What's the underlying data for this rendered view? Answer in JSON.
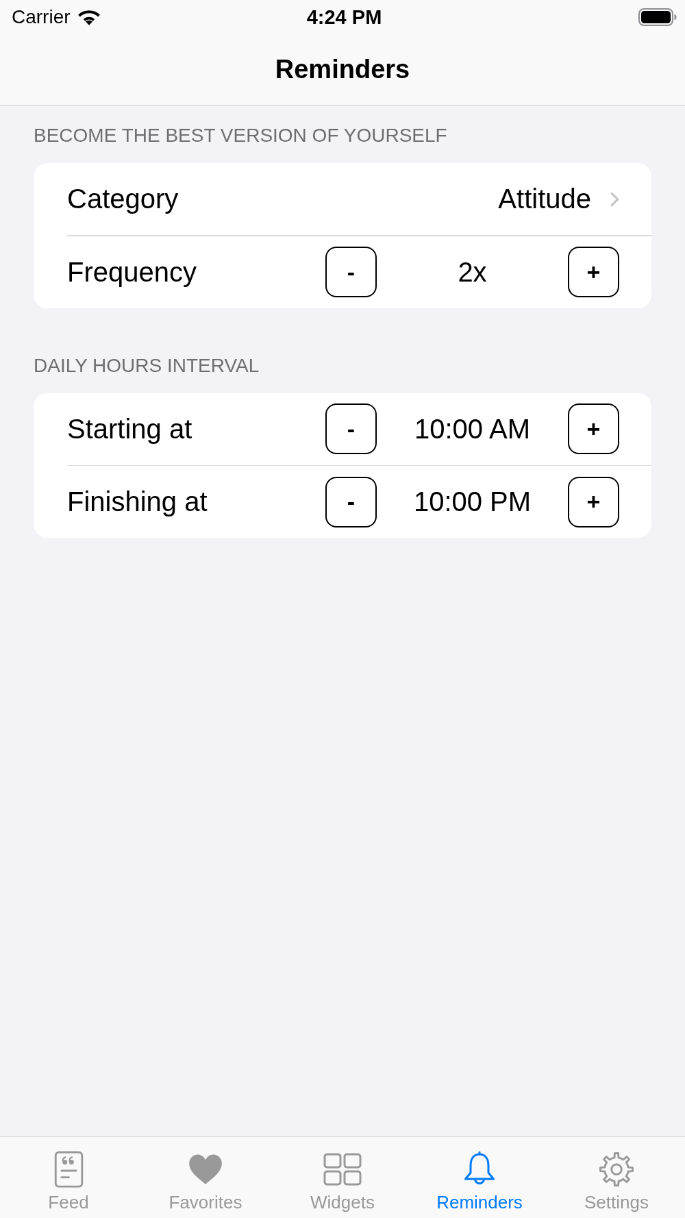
{
  "status_bar": {
    "carrier": "Carrier",
    "time": "4:24 PM"
  },
  "nav_bar": {
    "title": "Reminders"
  },
  "sections": [
    {
      "header": "BECOME THE BEST VERSION OF YOURSELF",
      "rows": [
        {
          "kind": "disclosure",
          "label": "Category",
          "value": "Attitude"
        },
        {
          "kind": "stepper",
          "label": "Frequency",
          "value": "2x",
          "decrement": "-",
          "increment": "+"
        }
      ]
    },
    {
      "header": "DAILY HOURS INTERVAL",
      "rows": [
        {
          "kind": "stepper",
          "label": "Starting at",
          "value": "10:00 AM",
          "decrement": "-",
          "increment": "+"
        },
        {
          "kind": "stepper",
          "label": "Finishing at",
          "value": "10:00 PM",
          "decrement": "-",
          "increment": "+"
        }
      ]
    }
  ],
  "tab_bar": {
    "tabs": [
      {
        "label": "Feed",
        "selected": false
      },
      {
        "label": "Favorites",
        "selected": false
      },
      {
        "label": "Widgets",
        "selected": false
      },
      {
        "label": "Reminders",
        "selected": true
      },
      {
        "label": "Settings",
        "selected": false
      }
    ]
  }
}
